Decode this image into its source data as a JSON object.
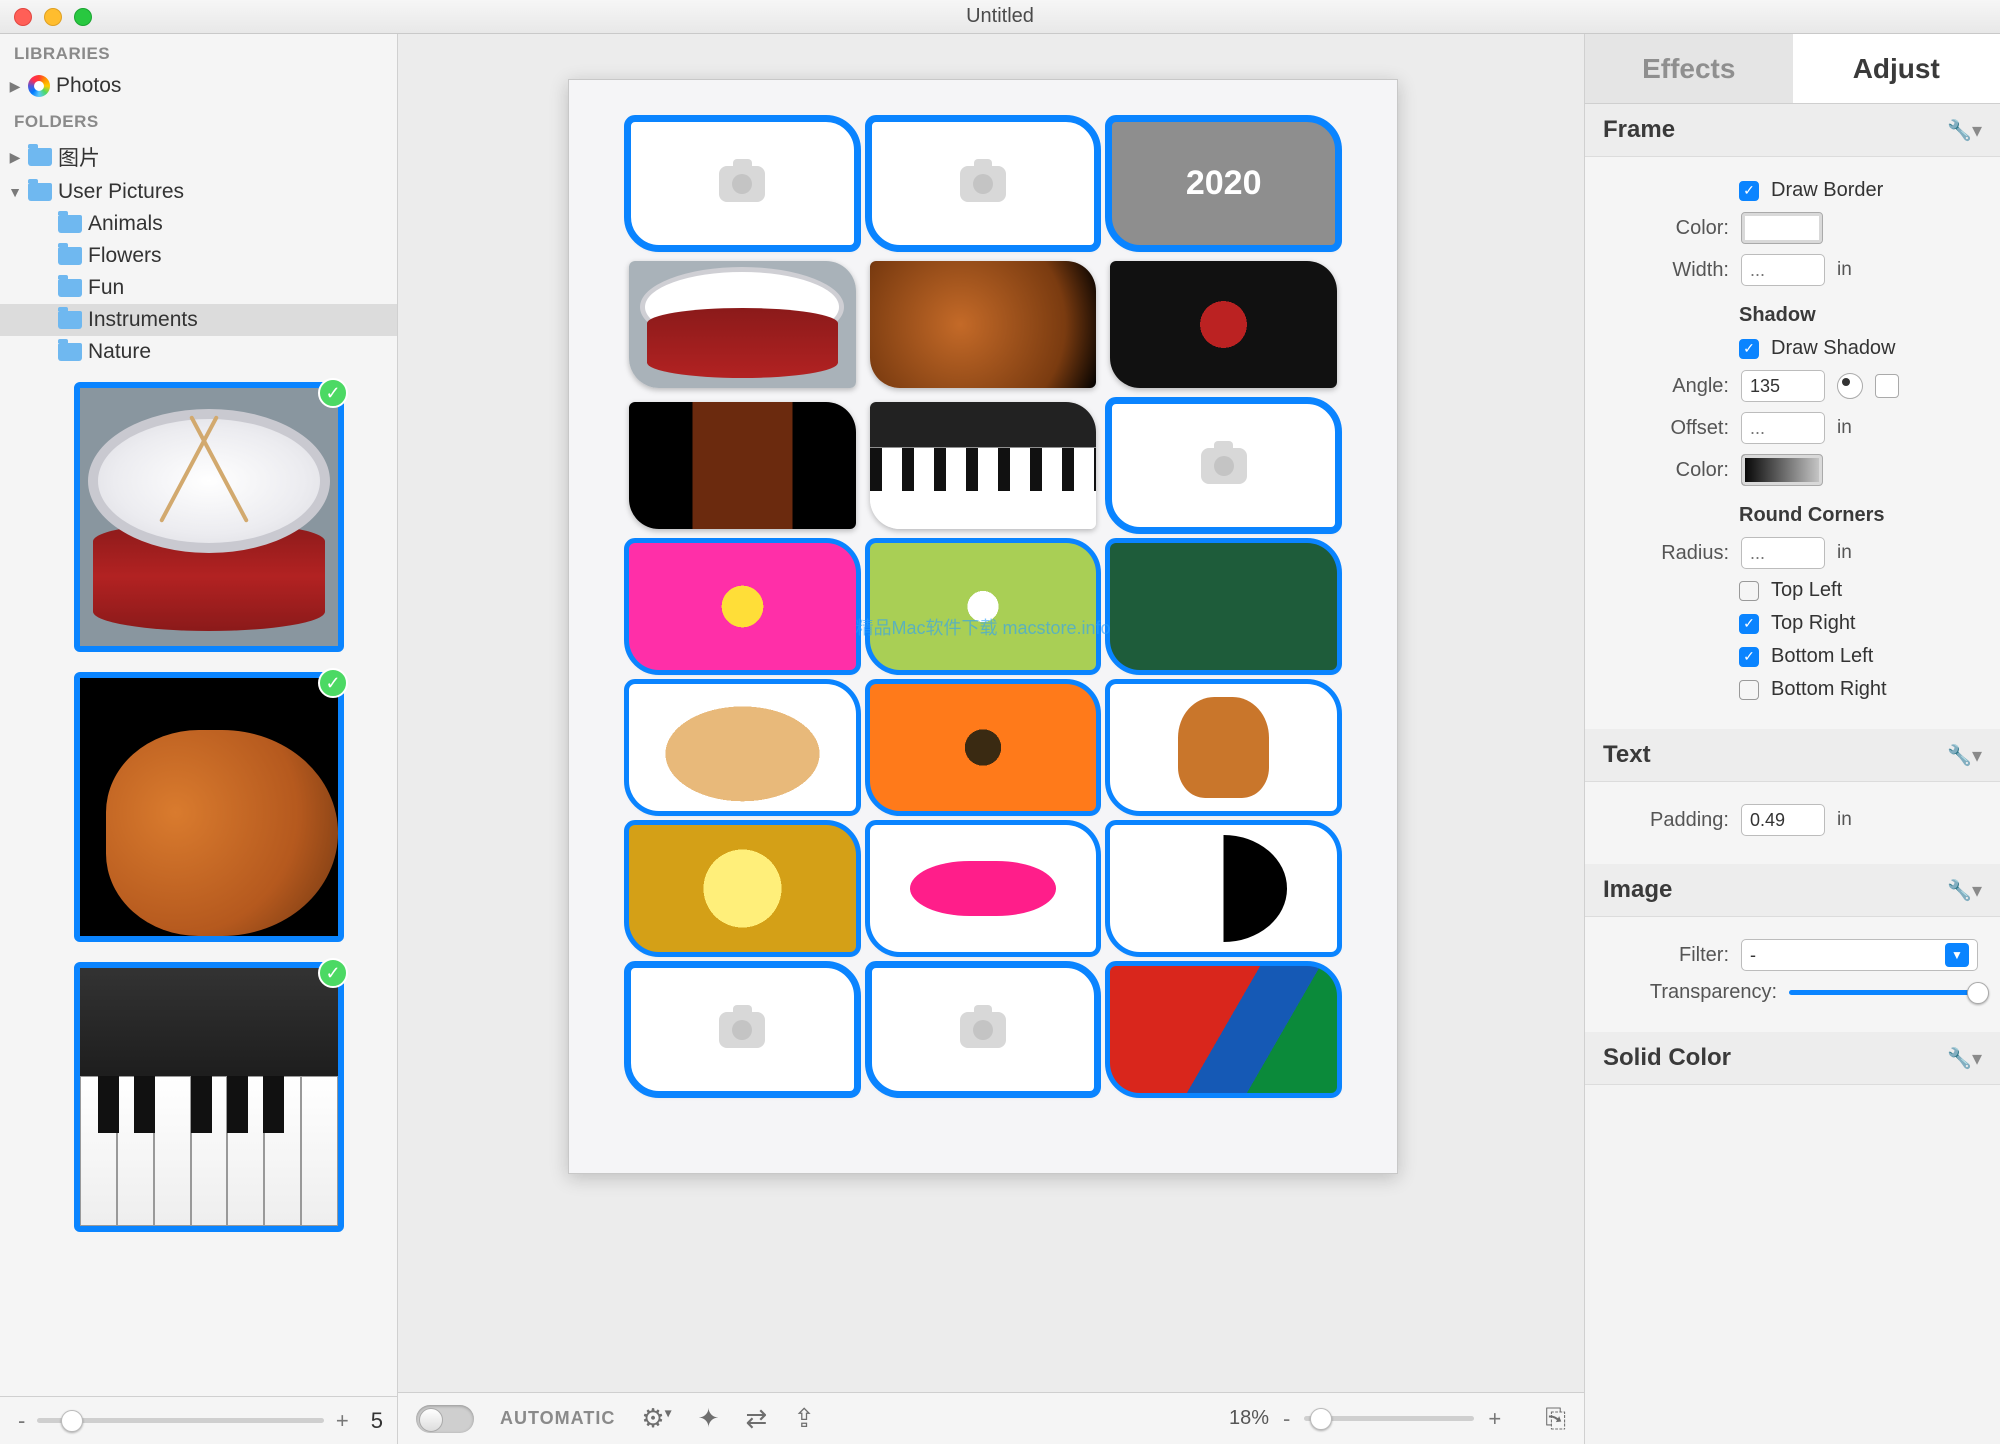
{
  "window": {
    "title": "Untitled"
  },
  "traffic": {
    "close": "close",
    "minimize": "minimize",
    "maximize": "maximize"
  },
  "sidebar": {
    "section_libraries": "LIBRARIES",
    "photos": "Photos",
    "section_folders": "FOLDERS",
    "folders": [
      {
        "label": "图片",
        "expanded": false
      },
      {
        "label": "User Pictures",
        "expanded": true,
        "children": [
          "Animals",
          "Flowers",
          "Fun",
          "Instruments",
          "Nature"
        ],
        "selected_index": 3
      }
    ],
    "thumbs": [
      "drum",
      "guitar",
      "piano"
    ],
    "zoom_minus": "-",
    "zoom_plus": "+",
    "count": "5"
  },
  "canvas": {
    "cells": [
      {
        "type": "placeholder",
        "selected": true
      },
      {
        "type": "placeholder",
        "selected": true
      },
      {
        "type": "year",
        "text": "2020",
        "selected": true
      },
      {
        "type": "img",
        "name": "drum",
        "selected": false
      },
      {
        "type": "img",
        "name": "guitar",
        "selected": false
      },
      {
        "type": "img",
        "name": "vinyl",
        "selected": false
      },
      {
        "type": "img",
        "name": "violin",
        "selected": false
      },
      {
        "type": "img",
        "name": "piano",
        "selected": false
      },
      {
        "type": "placeholder",
        "selected": true
      },
      {
        "type": "img",
        "name": "flower1",
        "selected": true
      },
      {
        "type": "img",
        "name": "dandelion",
        "selected": true
      },
      {
        "type": "img",
        "name": "chalk",
        "selected": true
      },
      {
        "type": "img",
        "name": "cookie",
        "selected": true
      },
      {
        "type": "img",
        "name": "gerbera",
        "selected": true
      },
      {
        "type": "img",
        "name": "ginger",
        "selected": true
      },
      {
        "type": "img",
        "name": "medal",
        "selected": true
      },
      {
        "type": "img",
        "name": "lips",
        "selected": true
      },
      {
        "type": "img",
        "name": "yy",
        "selected": true
      },
      {
        "type": "placeholder",
        "selected": true
      },
      {
        "type": "placeholder",
        "selected": true
      },
      {
        "type": "img",
        "name": "parrot",
        "selected": true
      }
    ],
    "watermark": "精品Mac软件下载 macstore.info"
  },
  "toolbar": {
    "automatic": "AUTOMATIC",
    "zoom_value": "18%",
    "zoom_minus": "-",
    "zoom_plus": "+",
    "icons": {
      "gear": "gear",
      "wand": "wand",
      "shuffle": "shuffle",
      "share": "share",
      "exit": "exit"
    }
  },
  "inspector": {
    "tabs": {
      "effects": "Effects",
      "adjust": "Adjust",
      "active": "adjust"
    },
    "frame": {
      "title": "Frame",
      "draw_border_label": "Draw Border",
      "draw_border": true,
      "color_label": "Color:",
      "width_label": "Width:",
      "width_placeholder": "...",
      "width_unit": "in",
      "shadow_title": "Shadow",
      "draw_shadow_label": "Draw Shadow",
      "draw_shadow": true,
      "angle_label": "Angle:",
      "angle_value": "135",
      "offset_label": "Offset:",
      "offset_placeholder": "...",
      "offset_unit": "in",
      "shadow_color_label": "Color:",
      "corners_title": "Round Corners",
      "radius_label": "Radius:",
      "radius_placeholder": "...",
      "radius_unit": "in",
      "tl_label": "Top Left",
      "tl": false,
      "tr_label": "Top Right",
      "tr": true,
      "bl_label": "Bottom Left",
      "bl": true,
      "br_label": "Bottom Right",
      "br": false
    },
    "text": {
      "title": "Text",
      "padding_label": "Padding:",
      "padding_value": "0.49",
      "padding_unit": "in"
    },
    "image": {
      "title": "Image",
      "filter_label": "Filter:",
      "filter_value": "-",
      "transparency_label": "Transparency:"
    },
    "solid": {
      "title": "Solid Color"
    }
  }
}
